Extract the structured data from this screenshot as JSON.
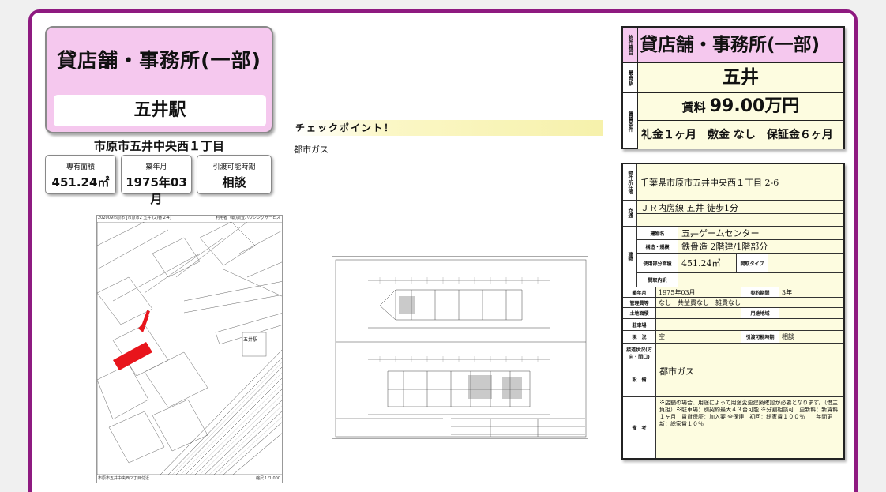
{
  "header": {
    "property_type": "貸店舗・事務所(一部)",
    "station": "五井駅",
    "address_short": "市原市五井中央西１丁目"
  },
  "stats": [
    {
      "label": "専有面積",
      "value": "451.24㎡"
    },
    {
      "label": "築年月",
      "value": "1975年03月"
    },
    {
      "label": "引渡可能時期",
      "value": "相談"
    }
  ],
  "map": {
    "top_left": "202009市原市 [市原市2 五井 (2)番 2-4]",
    "top_right": "利用者（転)調査ハウジングサービス",
    "bottom_left": "市原市五井中央西２丁目付近",
    "bottom_right": "縮尺１/1,000",
    "station_label": "五井駅"
  },
  "checkpoint": {
    "title": "チェックポイント！",
    "text": "都市ガス"
  },
  "summary": {
    "type_label": "物件種目",
    "type_value": "貸店舗・事務所(一部)",
    "station_label": "最寄駅",
    "station_value": "五井",
    "rent_label": "賃貸条件",
    "rent_prefix": "賃料",
    "rent_value": "99.00万円",
    "conditions": "礼金１ヶ月　敷金 なし　保証金６ヶ月"
  },
  "details": {
    "location_label": "物件所在地",
    "location": "千葉県市原市五井中央西１丁目 2-6",
    "transport_label": "交通",
    "transport": "ＪＲ内房線 五井 徒歩1分",
    "building_label": "建物",
    "building_name_label": "建物名",
    "building_name": "五井ゲームセンター",
    "structure_label": "構造・規模",
    "structure": "鉄骨造 2階建/1階部分",
    "area_label": "使用部分面積",
    "area": "451.24㎡",
    "layout_type_label": "間取タイプ",
    "layout_type": "",
    "layout_detail_label": "間取内訳",
    "layout_detail": "",
    "built_label": "築年月",
    "built": "1975年03月",
    "contract_label": "契約期間",
    "contract": "3年",
    "fees_label": "管理費等",
    "fees": "なし　共益費なし　雑費なし",
    "land_area_label": "土地面積",
    "land_area": "",
    "zoning_label": "用途地域",
    "zoning": "",
    "parking_label": "駐車場",
    "parking": "",
    "status_label": "現　況",
    "status": "空",
    "handover_label": "引渡可能時期",
    "handover": "相談",
    "road_label": "接道状況(方向・間口)",
    "road": "",
    "equipment_label": "設　備",
    "equipment": "都市ガス",
    "remarks_label": "備　考",
    "remarks": "※店舗の場合、用途によって用途変更建築確認が必要となります。（借主負担）※駐車場：別契約最大４３台可能 ※分割相談可　更新料：新賃料１ヶ月　賃貸保証：加入要 全保連　初回：総家賃１００％　　年間更新：総家賃１０％"
  }
}
